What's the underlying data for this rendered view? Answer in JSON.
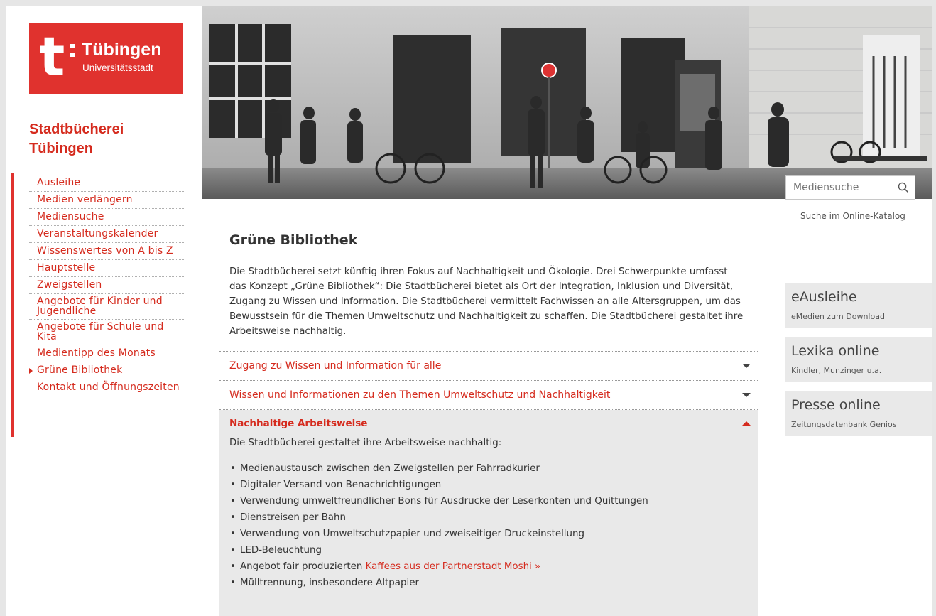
{
  "logo": {
    "letter": "t",
    "name": "Tübingen",
    "subtitle": "Universitätsstadt"
  },
  "site_title": "Stadtbücherei Tübingen",
  "nav": [
    {
      "label": "Ausleihe"
    },
    {
      "label": "Medien verlängern"
    },
    {
      "label": "Mediensuche"
    },
    {
      "label": "Veranstaltungskalender"
    },
    {
      "label": "Wissenswertes von A bis Z"
    },
    {
      "label": "Hauptstelle"
    },
    {
      "label": "Zweigstellen"
    },
    {
      "label": "Angebote für Kinder und Jugendliche"
    },
    {
      "label": "Angebote für Schule und Kita"
    },
    {
      "label": "Medientipp des Monats"
    },
    {
      "label": "Grüne Bibliothek"
    },
    {
      "label": "Kontakt und Öffnungszeiten"
    }
  ],
  "search": {
    "placeholder": "Mediensuche",
    "hint": "Suche im Online-Katalog"
  },
  "side_boxes": [
    {
      "title": "eAusleihe",
      "subtitle": "eMedien zum Download"
    },
    {
      "title": "Lexika online",
      "subtitle": "Kindler, Munzinger u.a."
    },
    {
      "title": "Presse online",
      "subtitle": "Zeitungsdatenbank Genios"
    }
  ],
  "main": {
    "title": "Grüne Bibliothek",
    "intro": "Die Stadtbücherei setzt künftig ihren Fokus auf Nachhaltigkeit und Ökologie. Drei Schwerpunkte umfasst das Konzept „Grüne Bibliothek“: Die Stadtbücherei bietet als Ort der Integration, Inklusion und Diversität, Zugang zu Wissen und Information. Die Stadtbücherei vermittelt Fachwissen an alle Altersgruppen, um das Bewusstsein für die Themen Umweltschutz und Nachhaltigkeit zu schaffen. Die Stadtbücherei gestaltet ihre Arbeitsweise nachhaltig.",
    "accordion": [
      {
        "title": "Zugang zu Wissen und Information für alle"
      },
      {
        "title": "Wissen und Informationen zu den Themen Umweltschutz und Nachhaltigkeit"
      },
      {
        "title": "Nachhaltige Arbeitsweise",
        "lead": "Die Stadtbücherei gestaltet ihre Arbeitsweise nachhaltig:",
        "items": [
          "Medienaustausch zwischen den Zweigstellen per Fahrradkurier",
          "Digitaler Versand von Benachrichtigungen",
          "Verwendung umweltfreundlicher Bons für Ausdrucke der Leserkonten und Quittungen",
          "Dienstreisen per Bahn",
          "Verwendung von Umweltschutzpapier und zweiseitiger Druckeinstellung",
          "LED-Beleuchtung",
          "Mülltrennung, insbesondere Altpapier"
        ],
        "coffee_prefix": "Angebot fair produzierten",
        "coffee_link": "Kaffees aus der Partnerstadt Moshi »"
      }
    ]
  },
  "colors": {
    "brand_red": "#e0322e",
    "link_red": "#d52b1e",
    "box_gray": "#e9e9e9"
  }
}
